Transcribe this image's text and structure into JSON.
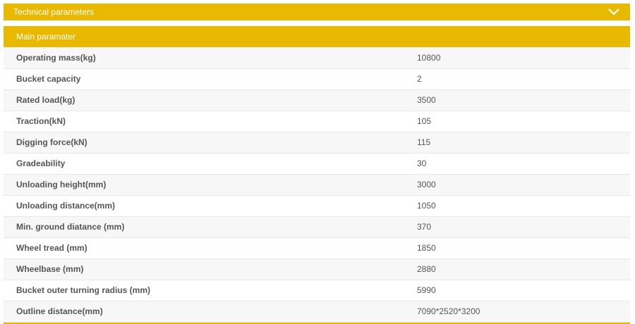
{
  "accordion": {
    "title": "Technical parameters",
    "toggle_icon": "chevron-down-icon"
  },
  "section": {
    "title": "Main paramater"
  },
  "parameters": [
    {
      "label": "Operating mass(kg)",
      "value": "10800"
    },
    {
      "label": "Bucket capacity",
      "value": "2"
    },
    {
      "label": "Rated load(kg)",
      "value": "3500"
    },
    {
      "label": "Traction(kN)",
      "value": "105"
    },
    {
      "label": "Digging force(kN)",
      "value": "115"
    },
    {
      "label": "Gradeability",
      "value": "30"
    },
    {
      "label": "Unloading height(mm)",
      "value": "3000"
    },
    {
      "label": "Unloading distance(mm)",
      "value": "1050"
    },
    {
      "label": "Min. ground diatance  (mm)",
      "value": "370"
    },
    {
      "label": "Wheel tread  (mm)",
      "value": "1850"
    },
    {
      "label": "Wheelbase  (mm)",
      "value": "2880"
    },
    {
      "label": "Bucket outer turning radius  (mm)",
      "value": "5990"
    },
    {
      "label": "Outline distance(mm)",
      "value": "7090*2520*3200"
    }
  ],
  "colors": {
    "accent": "#e8b900",
    "row_alt": "#f7f7f7"
  }
}
